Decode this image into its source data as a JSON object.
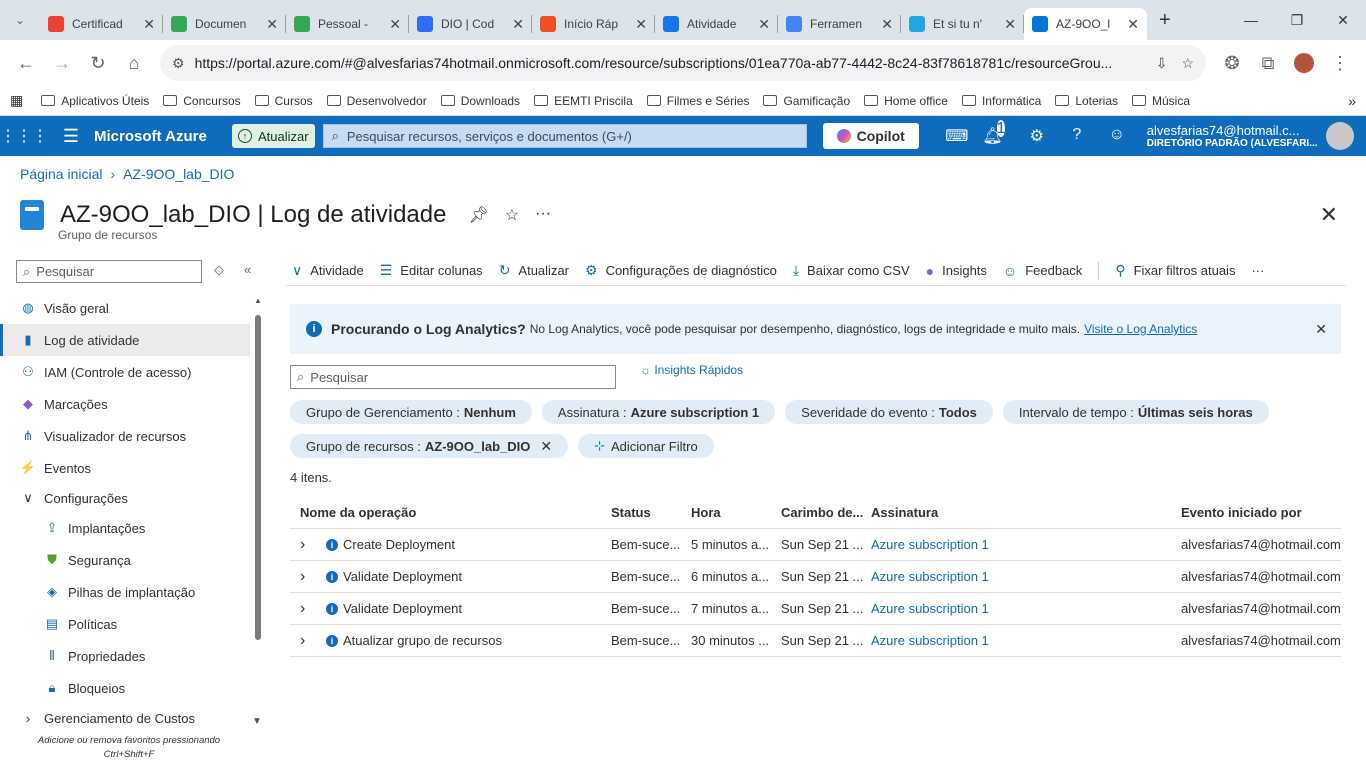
{
  "browser": {
    "tabs": [
      {
        "title": "Certificad",
        "icon_color": "#ea4335",
        "icon": "gmail-icon"
      },
      {
        "title": "Documen",
        "icon_color": "#34a853",
        "icon": "google-drive-icon"
      },
      {
        "title": "Pessoal - ",
        "icon_color": "#34a853",
        "icon": "google-drive-icon"
      },
      {
        "title": "DIO | Cod",
        "icon_color": "#2f6bff",
        "icon": "dio-icon"
      },
      {
        "title": "Início Ráp",
        "icon_color": "#f25022",
        "icon": "microsoft-icon"
      },
      {
        "title": "Atividade",
        "icon_color": "#1a73e8",
        "icon": "refresh-icon"
      },
      {
        "title": "Ferramen",
        "icon_color": "#4285f4",
        "icon": "google-docs-icon"
      },
      {
        "title": "Et si tu n'",
        "icon_color": "#23a6e0",
        "icon": "edge-icon"
      },
      {
        "title": "AZ-9OO_l",
        "icon_color": "#0078d4",
        "icon": "azure-icon"
      }
    ],
    "url": "https://portal.azure.com/#@alvesfarias74hotmail.onmicrosoft.com/resource/subscriptions/01ea770a-ab77-4442-8c24-83f78618781c/resourceGrou...",
    "bookmarks": [
      "Aplicativos Úteis",
      "Concursos",
      "Cursos",
      "Desenvolvedor",
      "Downloads",
      "EEMTI Priscila",
      "Filmes e Séries",
      "Gamificação",
      "Home office",
      "Informática",
      "Loterias",
      "Música"
    ]
  },
  "azure": {
    "brand": "Microsoft Azure",
    "update_label": "Atualizar",
    "search_placeholder": "Pesquisar recursos, serviços e documentos (G+/)",
    "copilot_label": "Copilot",
    "notification_count": "1",
    "account_name": "alvesfarias74@hotmail.c...",
    "account_dir": "DIRETÓRIO PADRÃO (ALVESFARI..."
  },
  "breadcrumb": {
    "home": "Página inicial",
    "current": "AZ-9OO_lab_DIO"
  },
  "page": {
    "resource": "AZ-9OO_lab_DIO",
    "section": "| Log de atividade",
    "subtitle": "Grupo de recursos"
  },
  "sidebar": {
    "search_placeholder": "Pesquisar",
    "items": [
      {
        "label": "Visão geral",
        "icon": "overview-icon"
      },
      {
        "label": "Log de atividade",
        "icon": "activity-log-icon"
      },
      {
        "label": "IAM (Controle de acesso)",
        "icon": "iam-icon"
      },
      {
        "label": "Marcações",
        "icon": "tag-icon"
      },
      {
        "label": "Visualizador de recursos",
        "icon": "resource-visualizer-icon"
      },
      {
        "label": "Eventos",
        "icon": "lightning-icon"
      },
      {
        "label": "Configurações",
        "icon": "chevron-down-icon"
      },
      {
        "label": "Implantações",
        "icon": "deployments-icon"
      },
      {
        "label": "Segurança",
        "icon": "shield-icon"
      },
      {
        "label": "Pilhas de implantação",
        "icon": "deployment-stack-icon"
      },
      {
        "label": "Políticas",
        "icon": "policy-icon"
      },
      {
        "label": "Propriedades",
        "icon": "properties-icon"
      },
      {
        "label": "Bloqueios",
        "icon": "lock-icon"
      },
      {
        "label": "Gerenciamento de Custos",
        "icon": "chevron-right-icon"
      }
    ],
    "footer": "Adicione ou remova favoritos pressionando Ctrl+Shift+F"
  },
  "toolbar": {
    "activity": "Atividade",
    "edit_columns": "Editar colunas",
    "refresh": "Atualizar",
    "diag": "Configurações de diagnóstico",
    "csv": "Baixar como CSV",
    "insights": "Insights",
    "feedback": "Feedback",
    "pin": "Fixar filtros atuais"
  },
  "info": {
    "heading": "Procurando o Log Analytics?",
    "text": "No Log Analytics, você pode pesquisar por desempenho, diagnóstico, logs de integridade e muito mais.",
    "link": "Visite o Log Analytics"
  },
  "filters": {
    "search_placeholder": "Pesquisar",
    "quick_insights": "Insights Rápidos",
    "pills": [
      {
        "key": "Grupo de Gerenciamento :",
        "value": "Nenhum"
      },
      {
        "key": "Assinatura :",
        "value": "Azure subscription 1"
      },
      {
        "key": "Severidade do evento :",
        "value": "Todos"
      },
      {
        "key": "Intervalo de tempo :",
        "value": "Últimas seis horas"
      },
      {
        "key": "Grupo de recursos :",
        "value": "AZ-9OO_lab_DIO"
      }
    ],
    "add_filter": "Adicionar Filtro"
  },
  "table": {
    "count": "4 itens.",
    "headers": [
      "Nome da operação",
      "Status",
      "Hora",
      "Carimbo de...",
      "Assinatura",
      "Evento iniciado por"
    ],
    "rows": [
      [
        "Create Deployment",
        "Bem-suce...",
        "5 minutos a...",
        "Sun Sep 21 ...",
        "Azure subscription 1",
        "alvesfarias74@hotmail.com"
      ],
      [
        "Validate Deployment",
        "Bem-suce...",
        "6 minutos a...",
        "Sun Sep 21 ...",
        "Azure subscription 1",
        "alvesfarias74@hotmail.com"
      ],
      [
        "Validate Deployment",
        "Bem-suce...",
        "7 minutos a...",
        "Sun Sep 21 ...",
        "Azure subscription 1",
        "alvesfarias74@hotmail.com"
      ],
      [
        "Atualizar grupo de recursos",
        "Bem-suce...",
        "30 minutos ...",
        "Sun Sep 21 ...",
        "Azure subscription 1",
        "alvesfarias74@hotmail.com"
      ]
    ]
  }
}
